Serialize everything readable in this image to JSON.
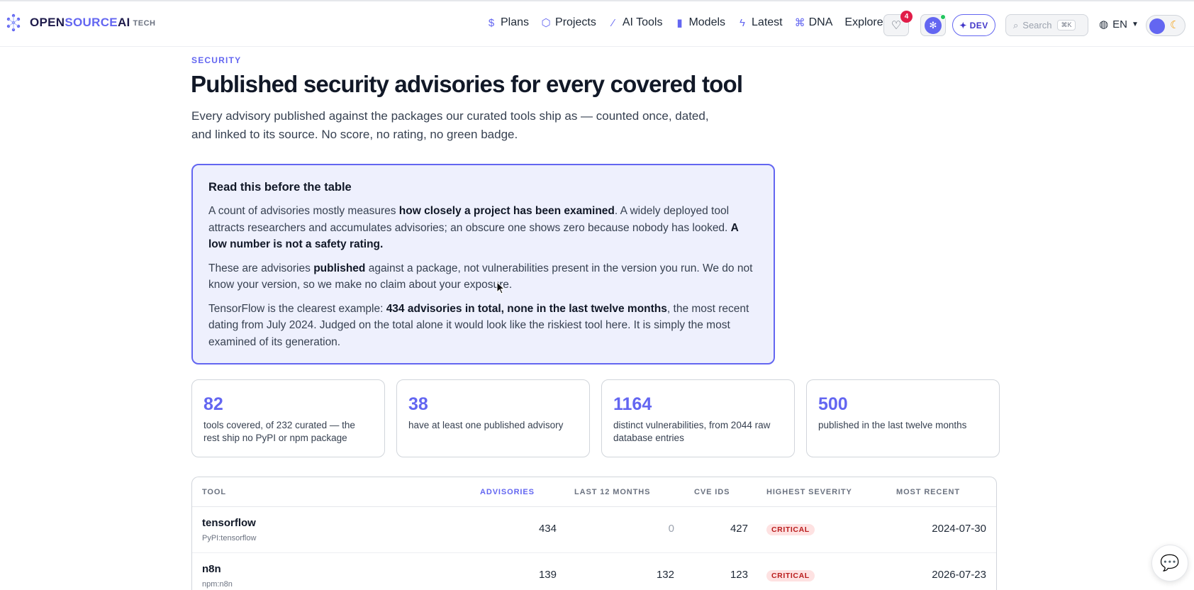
{
  "brand": {
    "name_part1": "OPEN",
    "name_part2": "SOURCE",
    "name_part3": "AI",
    "suffix": "TECH"
  },
  "nav": {
    "items": [
      {
        "label": "Plans",
        "icon": "dollar-icon"
      },
      {
        "label": "Projects",
        "icon": "cube-icon"
      },
      {
        "label": "AI Tools",
        "icon": "wand-icon"
      },
      {
        "label": "Models",
        "icon": "bar-chart-icon"
      },
      {
        "label": "Latest",
        "icon": "lightning-icon"
      },
      {
        "label": "DNA",
        "icon": "dna-icon"
      },
      {
        "label": "Explore",
        "icon": "chevron-down-icon"
      }
    ],
    "favorites_count": "4",
    "dev_label": "✦ DEV",
    "search_placeholder": "Search",
    "search_shortcut": "⌘K",
    "language": "EN"
  },
  "header": {
    "eyebrow": "SECURITY",
    "title": "Published security advisories for every covered tool",
    "lede": "Every advisory published against the packages our curated tools ship as — counted once, dated, and linked to its source. No score, no rating, no green badge."
  },
  "notice": {
    "title": "Read this before the table",
    "p1_a": "A count of advisories mostly measures ",
    "p1_b": "how closely a project has been examined",
    "p1_c": ". A widely deployed tool attracts researchers and accumulates advisories; an obscure one shows zero because nobody has looked. ",
    "p1_d": "A low number is not a safety rating.",
    "p2_a": "These are advisories ",
    "p2_b": "published",
    "p2_c": " against a package, not vulnerabilities present in the version you run. We do not know your version, so we make no claim about your exposure.",
    "p3_a": "TensorFlow is the clearest example: ",
    "p3_b": "434 advisories in total, none in the last twelve months",
    "p3_c": ", the most recent dating from July 2024. Judged on the total alone it would look like the riskiest tool here. It is simply the most examined of its generation."
  },
  "stats": [
    {
      "value": "82",
      "desc": "tools covered, of 232 curated — the rest ship no PyPI or npm package"
    },
    {
      "value": "38",
      "desc": "have at least one published advisory"
    },
    {
      "value": "1164",
      "desc": "distinct vulnerabilities, from 2044 raw database entries"
    },
    {
      "value": "500",
      "desc": "published in the last twelve months"
    }
  ],
  "table": {
    "headers": {
      "tool": "TOOL",
      "advisories": "ADVISORIES",
      "last12": "LAST 12 MONTHS",
      "cve": "CVE IDS",
      "severity": "HIGHEST SEVERITY",
      "recent": "MOST RECENT"
    },
    "rows": [
      {
        "name": "tensorflow",
        "pkg": "PyPI:tensorflow",
        "advisories": "434",
        "last12": "0",
        "cve": "427",
        "severity": "CRITICAL",
        "recent": "2024-07-30"
      },
      {
        "name": "n8n",
        "pkg": "npm:n8n",
        "advisories": "139",
        "last12": "132",
        "cve": "123",
        "severity": "CRITICAL",
        "recent": "2026-07-23"
      }
    ]
  },
  "colors": {
    "accent": "#6366f1",
    "critical_text": "#b91c1c",
    "critical_bg": "#fee2e2",
    "notice_bg": "#eef0fd"
  }
}
